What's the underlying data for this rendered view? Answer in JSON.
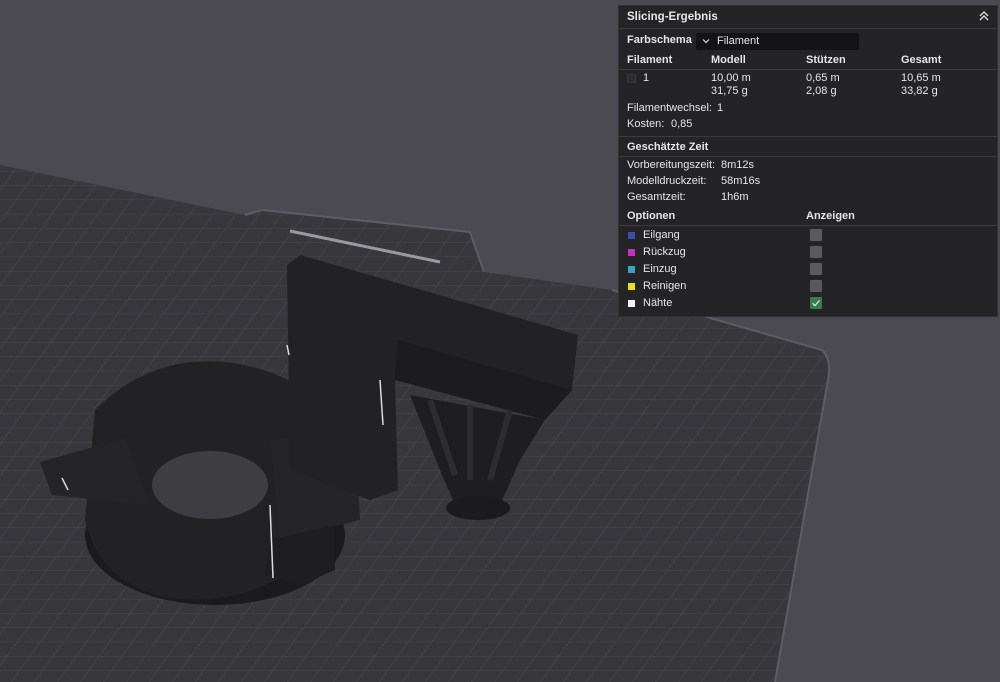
{
  "panel": {
    "title": "Slicing-Ergebnis",
    "color_scheme_label": "Farbschema",
    "color_scheme_value": "Filament",
    "table": {
      "headers": [
        "Filament",
        "Modell",
        "Stützen",
        "Gesamt"
      ],
      "row": {
        "filament": "1",
        "model_length": "10,00 m",
        "model_weight": "31,75 g",
        "support_length": "0,65 m",
        "support_weight": "2,08 g",
        "total_length": "10,65 m",
        "total_weight": "33,82 g"
      }
    },
    "filament_changes_label": "Filamentwechsel:",
    "filament_changes_value": "1",
    "cost_label": "Kosten:",
    "cost_value": "0,85",
    "time_section": "Geschätzte Zeit",
    "times": [
      {
        "label": "Vorbereitungszeit:",
        "value": "8m12s"
      },
      {
        "label": "Modelldruckzeit:",
        "value": "58m16s"
      },
      {
        "label": "Gesamtzeit:",
        "value": "1h6m"
      }
    ],
    "options_header": "Optionen",
    "show_header": "Anzeigen",
    "options": [
      {
        "label": "Eilgang",
        "color": "#3a4fb0",
        "checked": false
      },
      {
        "label": "Rückzug",
        "color": "#c52fc0",
        "checked": false
      },
      {
        "label": "Einzug",
        "color": "#3aa3c4",
        "checked": false
      },
      {
        "label": "Reinigen",
        "color": "#e6e21a",
        "checked": false
      },
      {
        "label": "Nähte",
        "color": "#f2f2f2",
        "checked": true
      }
    ],
    "icons": {
      "collapse": "double-chevron-up-icon",
      "dropdown": "chevron-down-icon",
      "check": "check-icon"
    }
  },
  "colors": {
    "background": "#4b4a50",
    "plate": "#38373c",
    "grid": "#48474d",
    "model": "#202022",
    "panel": "#242427",
    "checked": "#3a7a52"
  }
}
